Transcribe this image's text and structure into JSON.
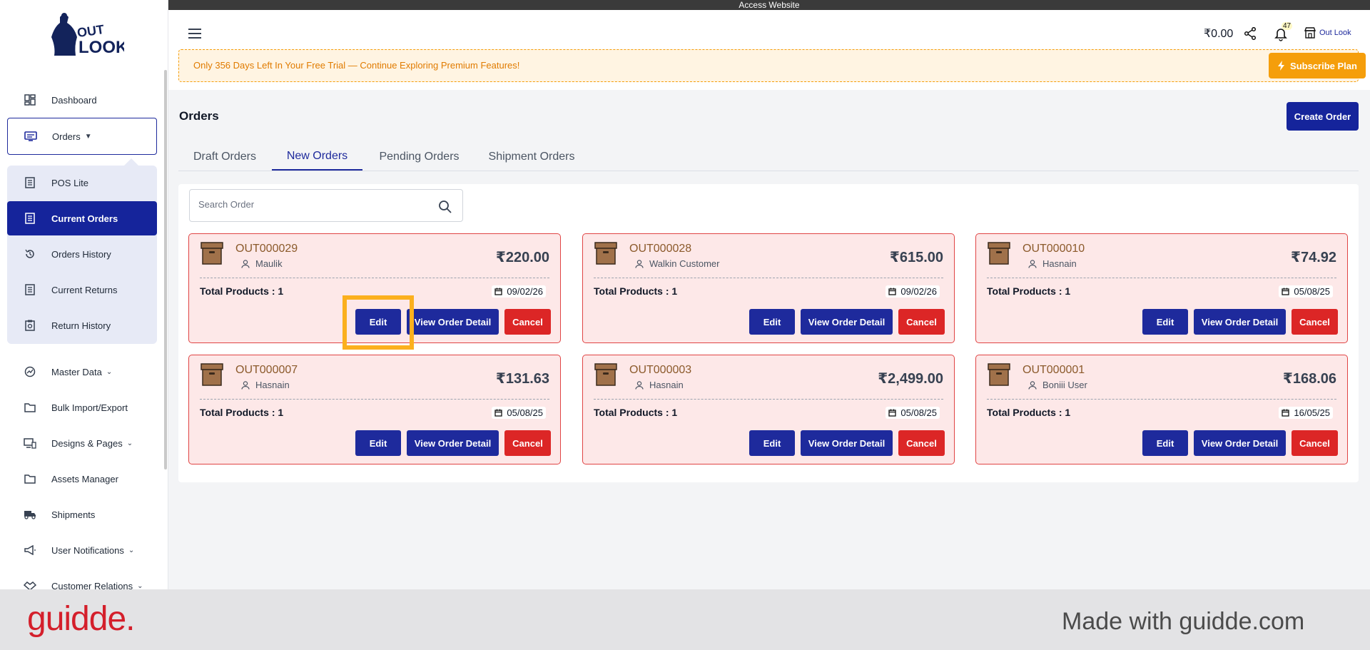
{
  "top_bar": {
    "label": "Access Website"
  },
  "brand": {
    "logo_text_1": "OUT",
    "logo_text_2": "LOOK"
  },
  "sidebar": {
    "items": [
      {
        "label": "Dashboard",
        "icon": "dashboard-icon"
      },
      {
        "label": "Orders",
        "icon": "orders-icon",
        "expanded": true
      },
      {
        "label": "POS Lite",
        "icon": "pos-icon"
      },
      {
        "label": "Current Orders",
        "icon": "current-orders-icon",
        "active": true
      },
      {
        "label": "Orders History",
        "icon": "history-icon"
      },
      {
        "label": "Current Returns",
        "icon": "returns-icon"
      },
      {
        "label": "Return History",
        "icon": "return-history-icon"
      },
      {
        "label": "Master Data",
        "icon": "master-data-icon"
      },
      {
        "label": "Bulk Import/Export",
        "icon": "folder-icon"
      },
      {
        "label": "Designs & Pages",
        "icon": "designs-icon"
      },
      {
        "label": "Assets Manager",
        "icon": "folder-icon"
      },
      {
        "label": "Shipments",
        "icon": "truck-icon"
      },
      {
        "label": "User Notifications",
        "icon": "megaphone-icon"
      },
      {
        "label": "Customer Relations",
        "icon": "handshake-icon"
      }
    ]
  },
  "header": {
    "wallet": "₹0.00",
    "notification_count": "47",
    "store_name": "Out Look",
    "trial_message": "Only 356 Days Left In Your Free Trial — Continue Exploring Premium Features!",
    "subscribe_label": "Subscribe Plan"
  },
  "page": {
    "title": "Orders",
    "create_label": "Create Order",
    "tabs": [
      "Draft Orders",
      "New Orders",
      "Pending Orders",
      "Shipment Orders"
    ],
    "active_tab": "New Orders",
    "search_placeholder": "Search Order"
  },
  "card_labels": {
    "total_prefix": "Total Products : ",
    "edit": "Edit",
    "view": "View Order Detail",
    "cancel": "Cancel"
  },
  "orders": [
    {
      "id": "OUT000029",
      "customer": "Maulik",
      "amount": "₹220.00",
      "total_products": "1",
      "date": "09/02/26"
    },
    {
      "id": "OUT000028",
      "customer": "Walkin Customer",
      "amount": "₹615.00",
      "total_products": "1",
      "date": "09/02/26"
    },
    {
      "id": "OUT000010",
      "customer": "Hasnain",
      "amount": "₹74.92",
      "total_products": "1",
      "date": "05/08/25"
    },
    {
      "id": "OUT000007",
      "customer": "Hasnain",
      "amount": "₹131.63",
      "total_products": "1",
      "date": "05/08/25"
    },
    {
      "id": "OUT000003",
      "customer": "Hasnain",
      "amount": "₹2,499.00",
      "total_products": "1",
      "date": "05/08/25"
    },
    {
      "id": "OUT000001",
      "customer": "Boniii User",
      "amount": "₹168.06",
      "total_products": "1",
      "date": "16/05/25"
    }
  ],
  "footer": {
    "logo": "guidde.",
    "made_with": "Made with guidde.com"
  },
  "colors": {
    "primary": "#15249b",
    "danger": "#dc2626",
    "warning": "#f59e0b",
    "card_bg": "#fde8e8",
    "highlight": "#fbb01e"
  }
}
